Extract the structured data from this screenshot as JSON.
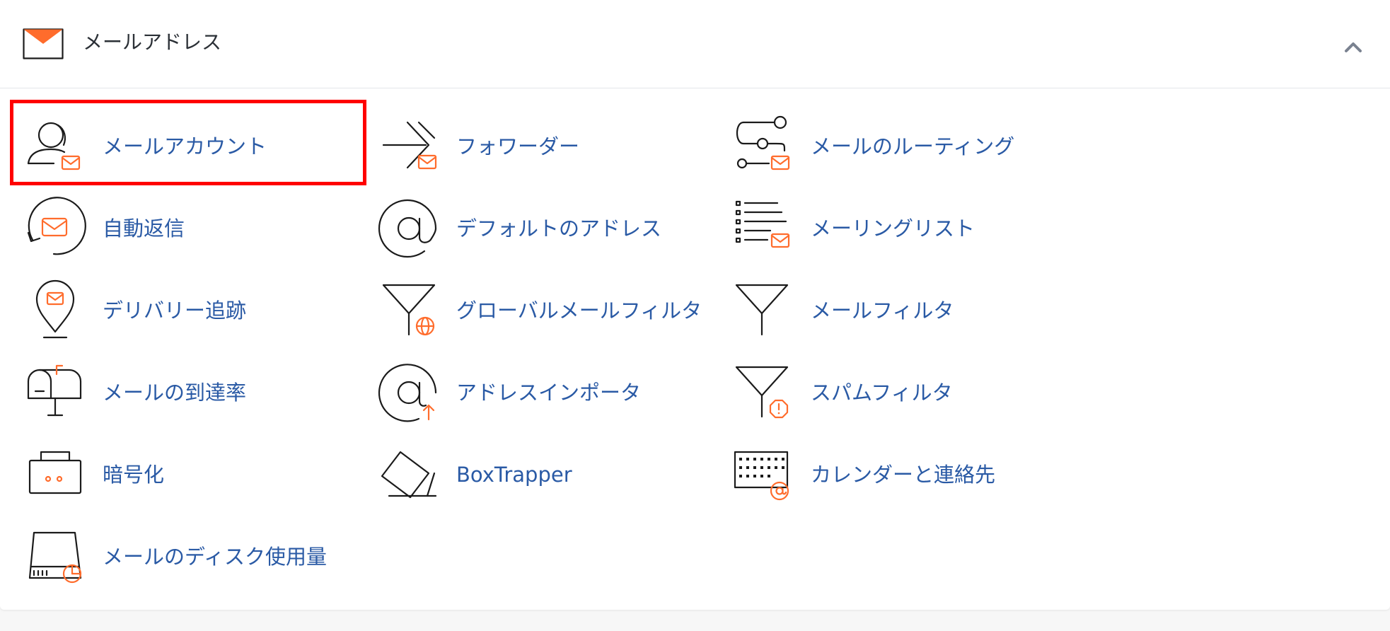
{
  "section": {
    "title": "メールアドレス",
    "icon": "envelope-icon",
    "collapse_icon": "chevron-up-icon"
  },
  "accent_color": "#ff6c2c",
  "link_color": "#2a5aa5",
  "highlight_color": "#ff0000",
  "items": [
    {
      "label": "メールアカウント",
      "icon": "mail-account-icon"
    },
    {
      "label": "フォワーダー",
      "icon": "forwarder-icon"
    },
    {
      "label": "メールのルーティング",
      "icon": "email-routing-icon"
    },
    {
      "label": "自動返信",
      "icon": "autoresponder-icon"
    },
    {
      "label": "デフォルトのアドレス",
      "icon": "at-sign-icon"
    },
    {
      "label": "メーリングリスト",
      "icon": "mailing-list-icon"
    },
    {
      "label": "デリバリー追跡",
      "icon": "delivery-pin-icon"
    },
    {
      "label": "グローバルメールフィルタ",
      "icon": "global-filter-icon"
    },
    {
      "label": "メールフィルタ",
      "icon": "filter-funnel-icon"
    },
    {
      "label": "メールの到達率",
      "icon": "mailbox-icon"
    },
    {
      "label": "アドレスインポータ",
      "icon": "address-import-icon"
    },
    {
      "label": "スパムフィルタ",
      "icon": "spam-filter-icon"
    },
    {
      "label": "暗号化",
      "icon": "encryption-icon"
    },
    {
      "label": "BoxTrapper",
      "icon": "boxtrapper-icon"
    },
    {
      "label": "カレンダーと連絡先",
      "icon": "calendar-contacts-icon"
    },
    {
      "label": "メールのディスク使用量",
      "icon": "disk-usage-icon"
    }
  ]
}
